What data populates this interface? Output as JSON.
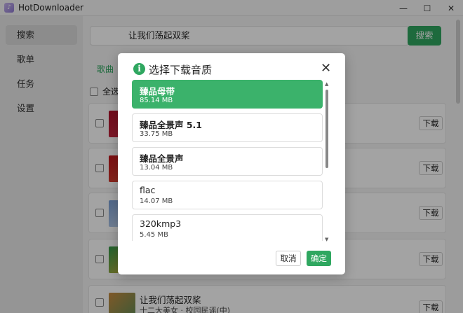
{
  "window": {
    "title": "HotDownloader",
    "minimize_glyph": "—",
    "maximize_glyph": "☐",
    "close_glyph": "✕"
  },
  "sidebar": {
    "items": [
      {
        "label": "搜索",
        "active": true
      },
      {
        "label": "歌单",
        "active": false
      },
      {
        "label": "任务",
        "active": false
      },
      {
        "label": "设置",
        "active": false
      }
    ]
  },
  "search": {
    "query": "让我们荡起双桨",
    "button_label": "搜索"
  },
  "results": {
    "tab_label": "歌曲",
    "select_all_label": "全选",
    "download_label": "下载",
    "visible_song": {
      "name": "让我们荡起双桨",
      "artist": "十二大美女 · 校园民谣(中)"
    }
  },
  "dialog": {
    "icon_glyph": "i",
    "title": "选择下载音质",
    "close_glyph": "✕",
    "options": [
      {
        "name": "臻品母带",
        "size": "85.14 MB",
        "selected": true
      },
      {
        "name": "臻品全景声 5.1",
        "size": "33.75 MB",
        "selected": false
      },
      {
        "name": "臻品全景声",
        "size": "13.04 MB",
        "selected": false
      },
      {
        "name": "flac",
        "size": "14.07 MB",
        "selected": false
      },
      {
        "name": "320kmp3",
        "size": "5.45 MB",
        "selected": false
      }
    ],
    "cancel_label": "取消",
    "ok_label": "确定"
  },
  "colors": {
    "accent": "#2fa760",
    "selected_option": "#3bb26b"
  }
}
